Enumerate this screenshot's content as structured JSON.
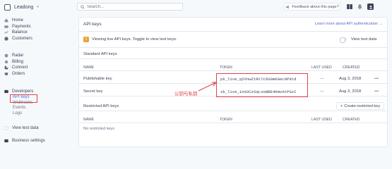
{
  "account": {
    "name": "Leadong"
  },
  "nav": {
    "group1": [
      {
        "label": "Home",
        "icon": "home-icon"
      },
      {
        "label": "Payments",
        "icon": "payments-icon"
      },
      {
        "label": "Balance",
        "icon": "balance-icon"
      },
      {
        "label": "Customers",
        "icon": "customers-icon"
      }
    ],
    "group2": [
      {
        "label": "Radar",
        "icon": "radar-icon"
      },
      {
        "label": "Billing",
        "icon": "billing-icon"
      },
      {
        "label": "Connect",
        "icon": "connect-icon"
      },
      {
        "label": "Orders",
        "icon": "orders-icon"
      }
    ],
    "developers": {
      "label": "Developers",
      "icon": "developers-icon"
    },
    "dev_sub": [
      "API keys",
      "Webhooks",
      "Events",
      "Logs"
    ],
    "view_test": "View test data",
    "business": "Business settings"
  },
  "topbar": {
    "search_placeholder": "Search...",
    "feedback": "Feedback about this page?"
  },
  "card": {
    "title": "API keys",
    "learn_more": "Learn more about API authentication →",
    "notice": "Viewing live API keys. Toggle to view test keys.",
    "toggle_label": "View test data",
    "standard": {
      "title": "Standard API keys",
      "columns": [
        "NAME",
        "TOKEN",
        "LAST USED",
        "CREATED"
      ],
      "rows": [
        {
          "name": "Publishable key",
          "token": "pk_live_q2VnwZtRtlt6UGmKGec0P9td",
          "last_used": "—",
          "created": "Aug 3, 2018"
        },
        {
          "name": "Secret key",
          "token": "sk_live_1nG3CzSqLsoWBE4KmvAtPGzI",
          "last_used": "—",
          "created": "Aug 3, 2018"
        }
      ]
    },
    "restricted": {
      "title": "Restricted API keys",
      "create_label": "Create restricted key",
      "columns": [
        "NAME",
        "TOKEN",
        "LAST USED",
        "CREATED"
      ],
      "empty": "No restricted keys"
    }
  },
  "annotation": "公钥与私钥",
  "colors": {
    "accent": "#5469d4",
    "highlight": "#e0434a",
    "warning": "#e5a53a"
  }
}
